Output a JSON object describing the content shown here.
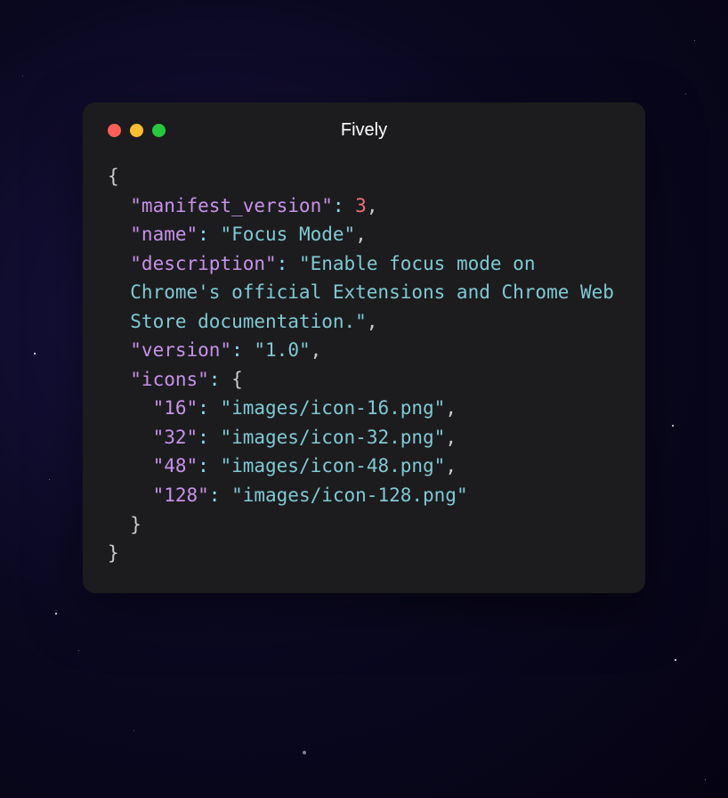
{
  "window": {
    "title": "Fively"
  },
  "code": {
    "k_manifest_version": "\"manifest_version\"",
    "v_manifest_version": "3",
    "k_name": "\"name\"",
    "v_name": "\"Focus Mode\"",
    "k_description": "\"description\"",
    "v_description": "\"Enable focus mode on Chrome's official Extensions and Chrome Web Store documentation.\"",
    "k_version": "\"version\"",
    "v_version": "\"1.0\"",
    "k_icons": "\"icons\"",
    "k_icon16": "\"16\"",
    "v_icon16": "\"images/icon-16.png\"",
    "k_icon32": "\"32\"",
    "v_icon32": "\"images/icon-32.png\"",
    "k_icon48": "\"48\"",
    "v_icon48": "\"images/icon-48.png\"",
    "k_icon128": "\"128\"",
    "v_icon128": "\"images/icon-128.png\""
  }
}
